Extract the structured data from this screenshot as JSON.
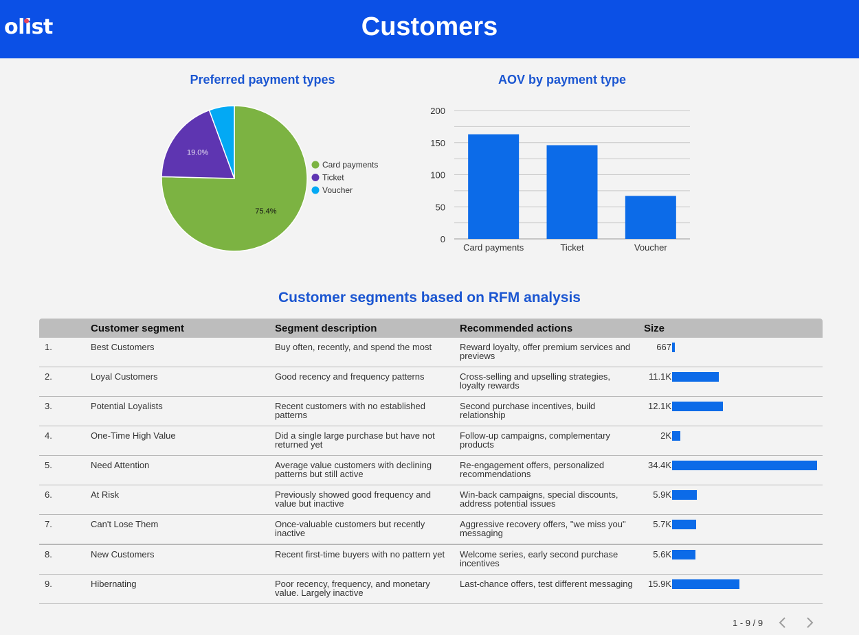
{
  "header": {
    "logo": "olist",
    "title": "Customers",
    "background": "#0b50e6"
  },
  "pie": {
    "title": "Preferred payment types",
    "chart_data": {
      "type": "pie",
      "slices": [
        {
          "label": "Card payments",
          "value": 75.4,
          "color": "#7cb342",
          "data_label": "75.4%"
        },
        {
          "label": "Ticket",
          "value": 19.0,
          "color": "#5e35b1",
          "data_label": "19.0%"
        },
        {
          "label": "Voucher",
          "value": 5.6,
          "color": "#03a9f4",
          "data_label": ""
        }
      ],
      "legend": "right"
    }
  },
  "bar": {
    "title": "AOV by payment type",
    "chart_data": {
      "type": "bar",
      "categories": [
        "Card payments",
        "Ticket",
        "Voucher"
      ],
      "values": [
        163,
        146,
        67
      ],
      "ylim": [
        0,
        200
      ],
      "yticks": [
        0,
        50,
        100,
        150,
        200
      ],
      "color": "#0c6be8",
      "grid": true
    }
  },
  "segments": {
    "title": "Customer segments based on RFM analysis",
    "columns": [
      "Customer segment",
      "Segment description",
      "Recommended actions",
      "Size"
    ],
    "max_size": 34.4,
    "rows": [
      {
        "num": "1.",
        "segment": "Best Customers",
        "description": "Buy often, recently, and spend the most",
        "actions": "Reward loyalty, offer premium services and previews",
        "size_label": "667",
        "size": 0.667
      },
      {
        "num": "2.",
        "segment": "Loyal Customers",
        "description": "Good recency and frequency patterns",
        "actions": "Cross-selling and upselling strategies, loyalty rewards",
        "size_label": "11.1K",
        "size": 11.1
      },
      {
        "num": "3.",
        "segment": "Potential Loyalists",
        "description": "Recent customers with no established patterns",
        "actions": "Second purchase incentives, build relationship",
        "size_label": "12.1K",
        "size": 12.1
      },
      {
        "num": "4.",
        "segment": "One-Time High Value",
        "description": "Did a single large purchase but have not returned yet",
        "actions": "Follow-up campaigns, complementary products",
        "size_label": "2K",
        "size": 2.0
      },
      {
        "num": "5.",
        "segment": "Need Attention",
        "description": "Average value customers with declining patterns but still active",
        "actions": "Re-engagement offers, personalized recommendations",
        "size_label": "34.4K",
        "size": 34.4
      },
      {
        "num": "6.",
        "segment": "At Risk",
        "description": "Previously showed good frequency and value but inactive",
        "actions": "Win-back campaigns, special discounts, address potential issues",
        "size_label": "5.9K",
        "size": 5.9
      },
      {
        "num": "7.",
        "segment": "Can't Lose Them",
        "description": "Once-valuable customers but recently inactive",
        "actions": "Aggressive recovery offers, \"we miss you\" messaging",
        "size_label": "5.7K",
        "size": 5.7
      },
      {
        "num": "8.",
        "segment": "New Customers",
        "description": "Recent first-time buyers with no pattern yet",
        "actions": "Welcome series, early second purchase incentives",
        "size_label": "5.6K",
        "size": 5.6
      },
      {
        "num": "9.",
        "segment": "Hibernating",
        "description": "Poor recency, frequency, and monetary value. Largely inactive",
        "actions": "Last-chance offers, test different messaging",
        "size_label": "15.9K",
        "size": 15.9
      }
    ],
    "pager": "1 - 9 / 9"
  }
}
